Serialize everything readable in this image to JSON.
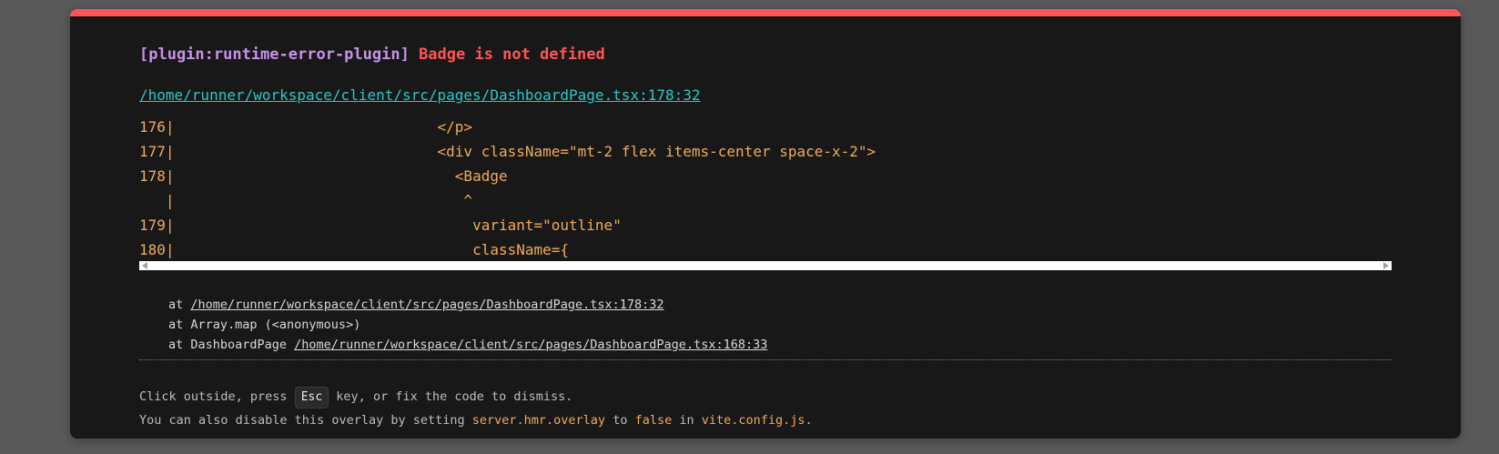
{
  "overlay": {
    "plugin_tag": "[plugin:runtime-error-plugin]",
    "message": "Badge is not defined",
    "file": "/home/runner/workspace/client/src/pages/DashboardPage.tsx:178:32",
    "code_lines": [
      {
        "num": "176",
        "code": "                              </p>"
      },
      {
        "num": "177",
        "code": "                              <div className=\"mt-2 flex items-center space-x-2\">"
      },
      {
        "num": "178",
        "code": "                                <Badge"
      },
      {
        "num": "",
        "code": "                                 ^"
      },
      {
        "num": "179",
        "code": "                                  variant=\"outline\""
      },
      {
        "num": "180",
        "code": "                                  className={"
      }
    ],
    "stack": [
      {
        "prefix": "at ",
        "loc": "/home/runner/workspace/client/src/pages/DashboardPage.tsx:178:32"
      },
      {
        "prefix": "at Array.map (<anonymous>)",
        "loc": ""
      },
      {
        "prefix": "at DashboardPage ",
        "loc": "/home/runner/workspace/client/src/pages/DashboardPage.tsx:168:33"
      }
    ],
    "tip": {
      "line1_before": "Click outside, press ",
      "key": "Esc",
      "line1_after": " key, or fix the code to dismiss.",
      "line2_before": "You can also disable this overlay by setting ",
      "config_key": "server.hmr.overlay",
      "line2_mid": " to ",
      "config_value": "false",
      "line2_in": " in ",
      "config_file": "vite.config.js",
      "line2_end": "."
    }
  },
  "colors": {
    "accent": "#ff5555",
    "plugin": "#c792ea",
    "link": "#2dc7c7",
    "code": "#f0ab5c",
    "background": "#181818"
  }
}
